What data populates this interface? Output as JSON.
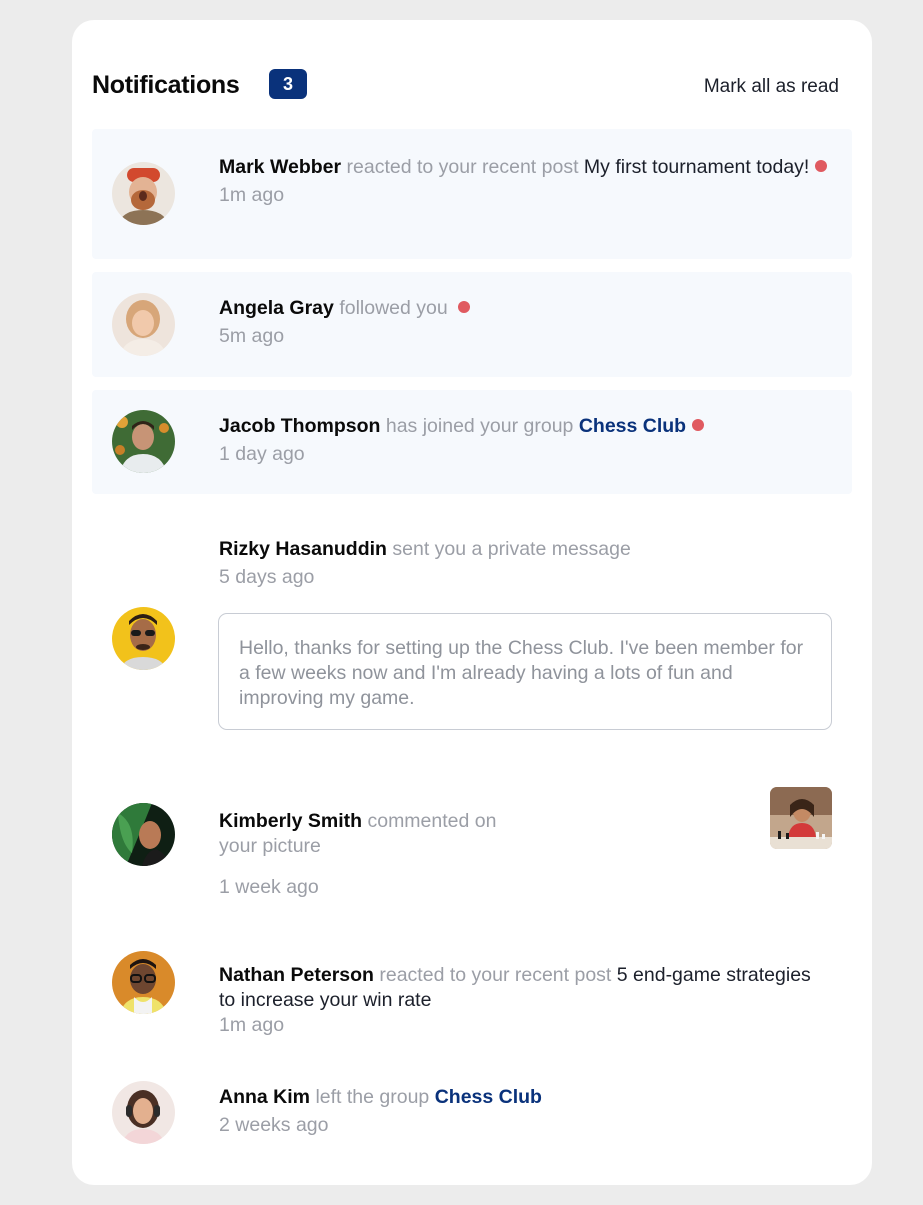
{
  "header": {
    "title": "Notifications",
    "unread_count": "3",
    "mark_all_label": "Mark all as read"
  },
  "notifications": [
    {
      "name": "Mark Webber",
      "action": "reacted to your recent post",
      "target": "My first tournament today!",
      "time": "1m ago",
      "unread": true
    },
    {
      "name": "Angela Gray",
      "action": "followed you",
      "time": "5m ago",
      "unread": true
    },
    {
      "name": "Jacob Thompson",
      "action": "has joined your group",
      "group": "Chess Club",
      "time": "1 day ago",
      "unread": true
    },
    {
      "name": "Rizky Hasanuddin",
      "action": "sent you a private message",
      "time": "5 days ago",
      "message": "Hello, thanks for setting up the Chess Club. I've been member for a few weeks now and I'm already having a lots of fun and improving my game.",
      "unread": false
    },
    {
      "name": "Kimberly Smith",
      "action": "commented on your picture",
      "time": "1 week ago",
      "unread": false
    },
    {
      "name": "Nathan Peterson",
      "action": "reacted to your recent post",
      "target": "5 end-game strategies to increase your win rate",
      "time": "1m ago",
      "unread": false
    },
    {
      "name": "Anna Kim",
      "action": "left the group",
      "group": "Chess Club",
      "time": "2 weeks ago",
      "unread": false
    }
  ],
  "colors": {
    "accent": "#0a327b",
    "unread_dot": "#e05a60",
    "unread_bg": "#f6f9fd",
    "muted_text": "#9b9ea6"
  }
}
